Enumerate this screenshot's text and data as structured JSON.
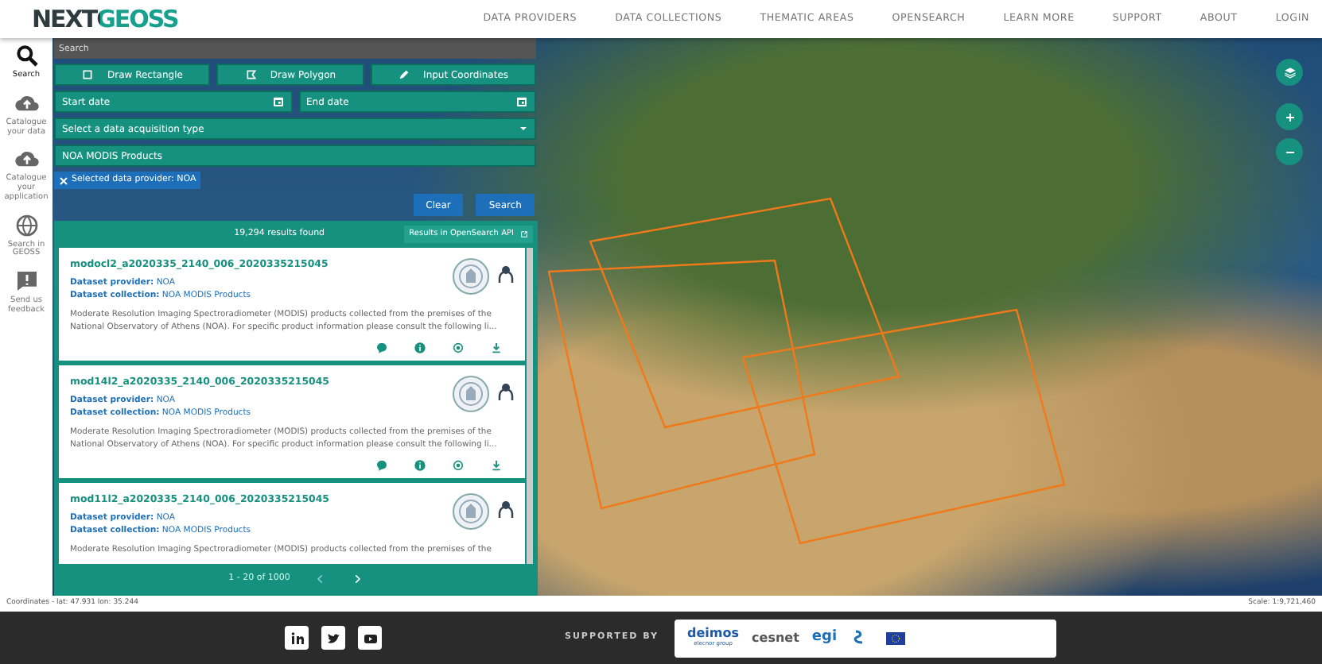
{
  "header": {
    "logo": "NEXTGEOSS",
    "nav": [
      "DATA PROVIDERS",
      "DATA COLLECTIONS",
      "THEMATIC AREAS",
      "OPENSEARCH",
      "LEARN MORE",
      "SUPPORT",
      "ABOUT",
      "LOGIN"
    ]
  },
  "sidebar": {
    "items": [
      {
        "label": "Search",
        "selected": true
      },
      {
        "label": "Catalogue your data",
        "selected": false
      },
      {
        "label": "Catalogue your application",
        "selected": false
      },
      {
        "label": "Search in GEOSS",
        "selected": false
      },
      {
        "label": "Send us feedback",
        "selected": false
      }
    ]
  },
  "search_panel": {
    "search_field": {
      "placeholder": "Search"
    },
    "draw_buttons": [
      "Draw Rectangle",
      "Draw Polygon",
      "Input Coordinates"
    ],
    "start_date": {
      "placeholder": "Start date"
    },
    "end_date": {
      "placeholder": "End date"
    },
    "acquisition_type": {
      "placeholder": "Select a data acquisition type"
    },
    "collection_field": {
      "value": "NOA MODIS Products"
    },
    "filter_chip": "Selected data provider: NOA",
    "buttons": [
      "Clear",
      "Search"
    ]
  },
  "results": {
    "count": "19,294 results found",
    "opensearch_button": "Results in OpenSearch API",
    "items": [
      {
        "title": "modocl2_a2020335_2140_006_2020335215045",
        "provider_label": "Dataset provider:",
        "provider": "NOA",
        "collection_label": "Dataset collection:",
        "collection": "NOA MODIS Products",
        "description": "Moderate Resolution Imaging Spectroradiometer (MODIS) products collected from the premises of the National Observatory of Athens (NOA). For specific product information please consult the following li...",
        "actions": true
      },
      {
        "title": "mod14l2_a2020335_2140_006_2020335215045",
        "provider_label": "Dataset provider:",
        "provider": "NOA",
        "collection_label": "Dataset collection:",
        "collection": "NOA MODIS Products",
        "description": "Moderate Resolution Imaging Spectroradiometer (MODIS) products collected from the premises of the National Observatory of Athens (NOA). For specific product information please consult the following li...",
        "actions": true
      },
      {
        "title": "mod11l2_a2020335_2140_006_2020335215045",
        "provider_label": "Dataset provider:",
        "provider": "NOA",
        "collection_label": "Dataset collection:",
        "collection": "NOA MODIS Products",
        "description": "Moderate Resolution Imaging Spectroradiometer (MODIS) products collected from the premises of the",
        "actions": false
      }
    ],
    "pagination": "1 - 20 of 1000"
  },
  "status_bar": {
    "coordinates": "Coordinates - lat: 47.931 lon: 35.244",
    "scale": "Scale: 1:9,721,460"
  },
  "footer": {
    "supported_by": "SUPPORTED BY",
    "sponsors": [
      "deimos",
      "elecnor group",
      "cesnet",
      "egi"
    ]
  }
}
